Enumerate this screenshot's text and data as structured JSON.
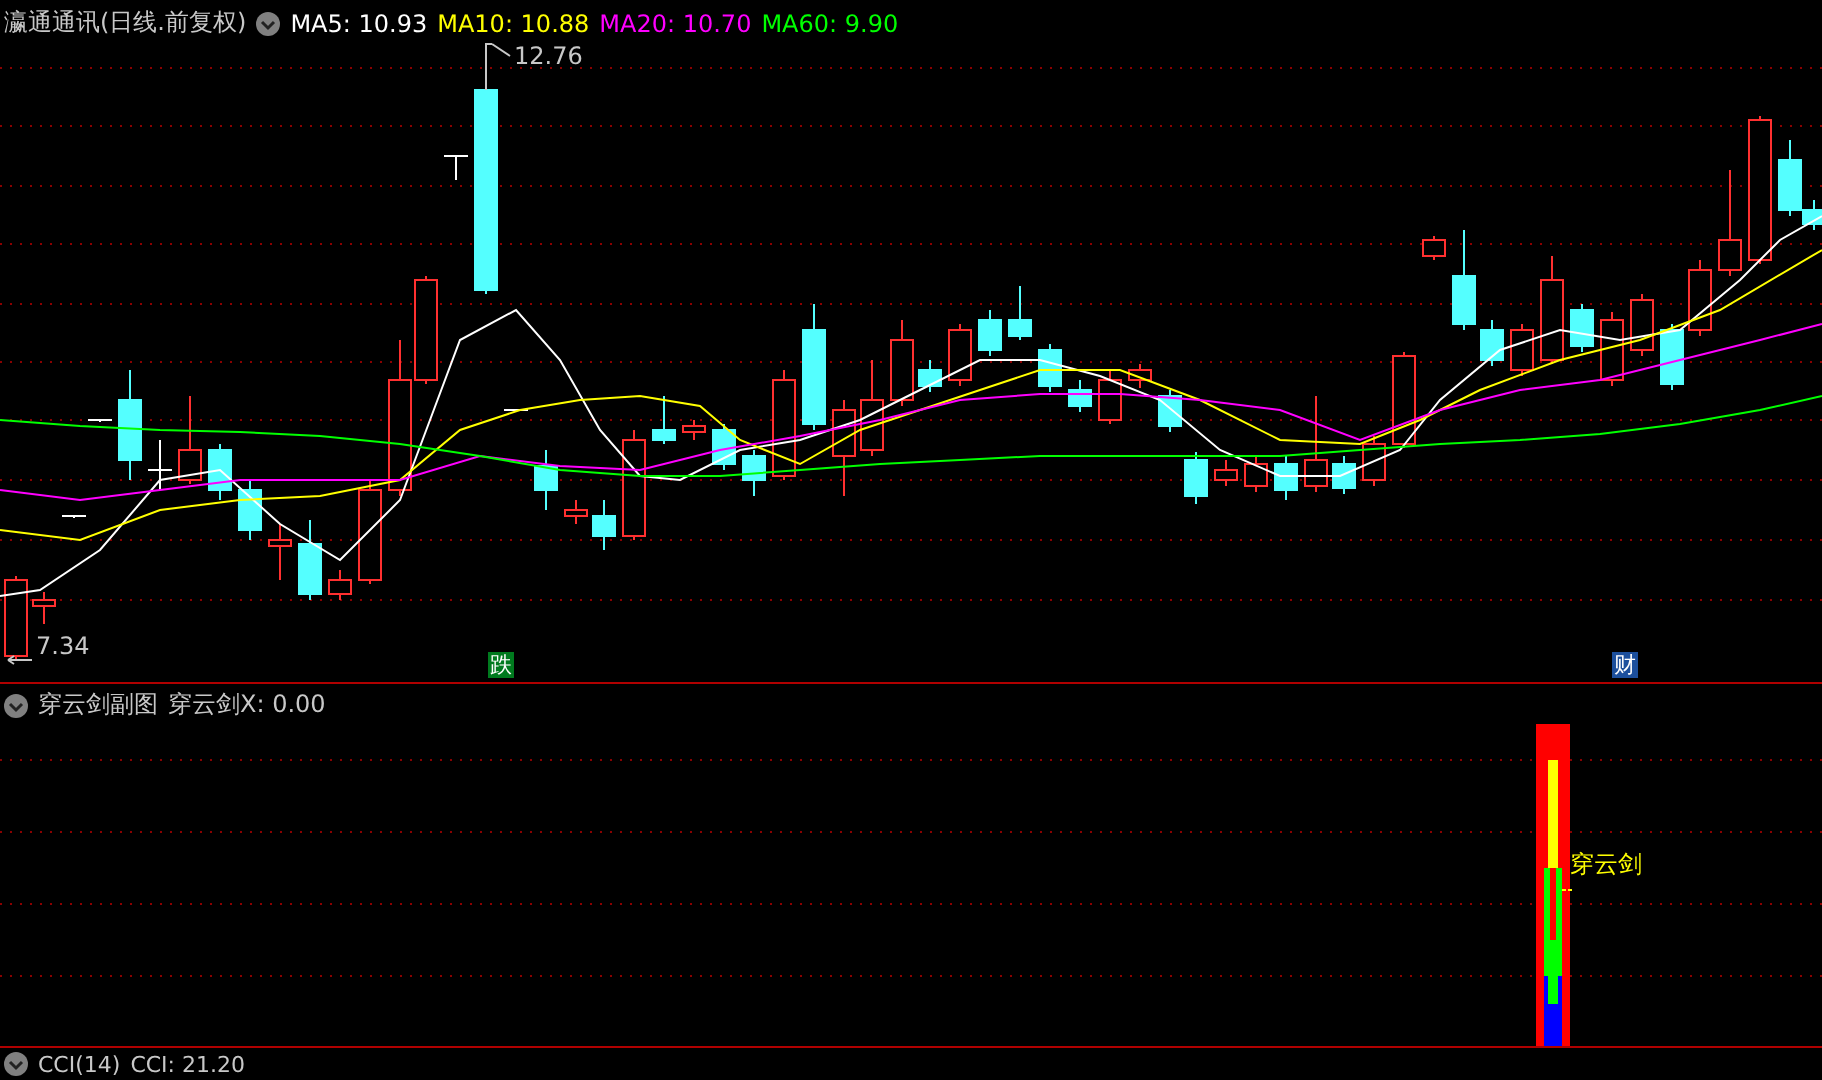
{
  "main": {
    "title": "瀛通通讯(日线.前复权)",
    "averages": [
      {
        "label": "MA5: 10.93",
        "color": "#ffffff"
      },
      {
        "label": "MA10: 10.88",
        "color": "#ffff00"
      },
      {
        "label": "MA20: 10.70",
        "color": "#ff00ff"
      },
      {
        "label": "MA60: 9.90",
        "color": "#00ff00"
      }
    ],
    "high_label": "12.76",
    "low_label": "7.34",
    "events": [
      {
        "label": "跌",
        "color": "#007a1e"
      },
      {
        "label": "财",
        "color": "#1c4f9c"
      }
    ]
  },
  "sub": {
    "title": "穿云剑副图",
    "reading": "穿云剑X: 0.00",
    "signal_label": "穿云剑"
  },
  "bottom": {
    "title": "CCI(14)",
    "reading": "CCI: 21.20"
  }
}
